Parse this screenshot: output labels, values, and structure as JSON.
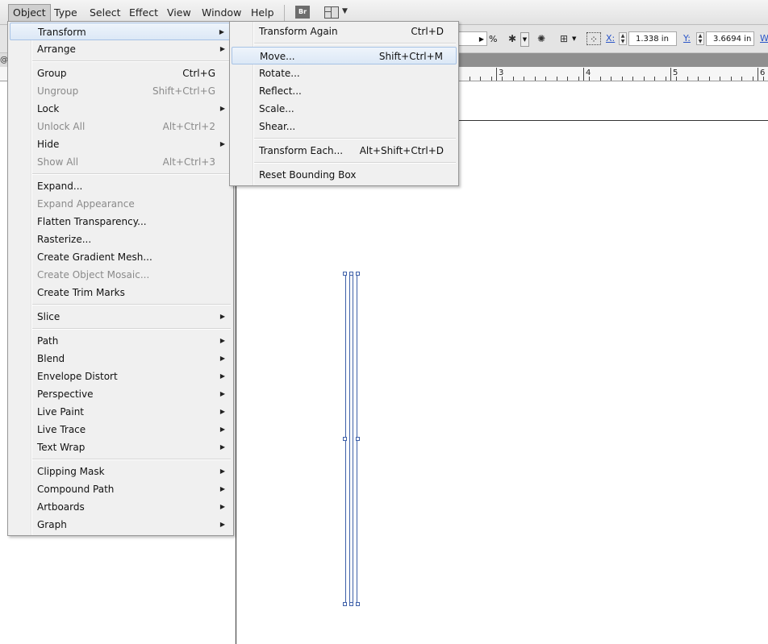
{
  "menubar": {
    "items": [
      "Object",
      "Type",
      "Select",
      "Effect",
      "View",
      "Window",
      "Help"
    ],
    "bridge_label": "Br"
  },
  "controlbar": {
    "percent_symbol": "%",
    "x_label": "X:",
    "x_value": "1.338 in",
    "y_label": "Y:",
    "y_value": "3.6694 in",
    "w_label": "W"
  },
  "tabstrip": {
    "at": "@"
  },
  "ruler": {
    "labels": [
      "3",
      "4",
      "5",
      "6"
    ]
  },
  "object_menu": {
    "items": [
      {
        "label": "Transform",
        "submenu": true,
        "highlighted": true
      },
      {
        "label": "Arrange",
        "submenu": true
      },
      {
        "label": "Group",
        "shortcut": "Ctrl+G"
      },
      {
        "label": "Ungroup",
        "shortcut": "Shift+Ctrl+G",
        "disabled": true
      },
      {
        "label": "Lock",
        "submenu": true
      },
      {
        "label": "Unlock All",
        "shortcut": "Alt+Ctrl+2",
        "disabled": true
      },
      {
        "label": "Hide",
        "submenu": true
      },
      {
        "label": "Show All",
        "shortcut": "Alt+Ctrl+3",
        "disabled": true
      },
      {
        "label": "Expand..."
      },
      {
        "label": "Expand Appearance",
        "disabled": true
      },
      {
        "label": "Flatten Transparency..."
      },
      {
        "label": "Rasterize..."
      },
      {
        "label": "Create Gradient Mesh..."
      },
      {
        "label": "Create Object Mosaic...",
        "disabled": true
      },
      {
        "label": "Create Trim Marks"
      },
      {
        "label": "Slice",
        "submenu": true
      },
      {
        "label": "Path",
        "submenu": true
      },
      {
        "label": "Blend",
        "submenu": true
      },
      {
        "label": "Envelope Distort",
        "submenu": true
      },
      {
        "label": "Perspective",
        "submenu": true
      },
      {
        "label": "Live Paint",
        "submenu": true
      },
      {
        "label": "Live Trace",
        "submenu": true
      },
      {
        "label": "Text Wrap",
        "submenu": true
      },
      {
        "label": "Clipping Mask",
        "submenu": true
      },
      {
        "label": "Compound Path",
        "submenu": true
      },
      {
        "label": "Artboards",
        "submenu": true
      },
      {
        "label": "Graph",
        "submenu": true
      }
    ]
  },
  "transform_menu": {
    "items": [
      {
        "label": "Transform Again",
        "shortcut": "Ctrl+D"
      },
      {
        "label": "Move...",
        "shortcut": "Shift+Ctrl+M",
        "highlighted": true
      },
      {
        "label": "Rotate..."
      },
      {
        "label": "Reflect..."
      },
      {
        "label": "Scale..."
      },
      {
        "label": "Shear..."
      },
      {
        "label": "Transform Each...",
        "shortcut": "Alt+Shift+Ctrl+D"
      },
      {
        "label": "Reset Bounding Box"
      }
    ]
  },
  "colors": {
    "highlight": "#dce8f6",
    "selection": "#3d5fa8",
    "menu_bg": "#f0f0f0"
  },
  "icons": [
    "submenu-arrow-icon",
    "bridge-icon",
    "arrange-documents-icon",
    "selection-tool-icon",
    "recolor-icon",
    "transform-reference-icon"
  ]
}
